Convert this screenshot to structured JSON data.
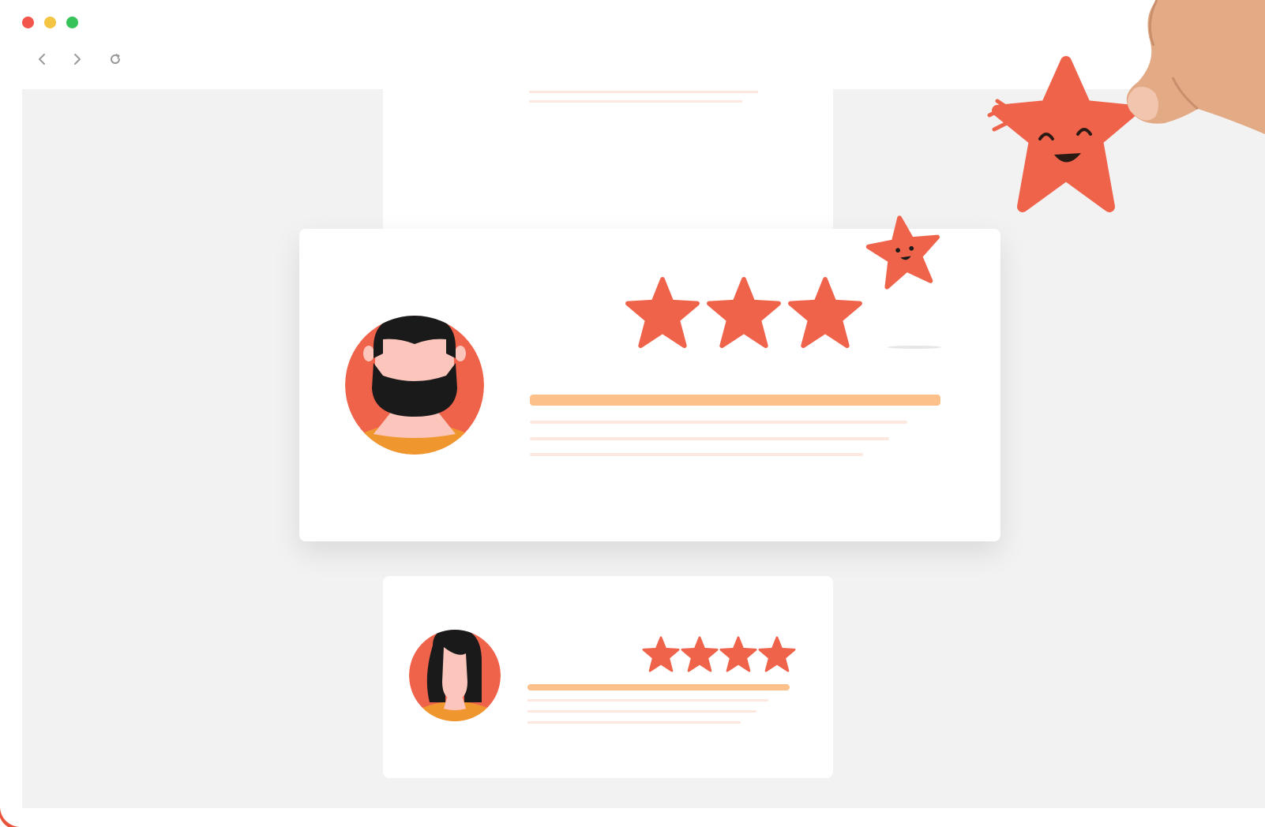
{
  "browser": {
    "traffic_lights": {
      "close": "#f2554b",
      "minimize": "#f4c542",
      "maximize": "#36c35a"
    },
    "nav": {
      "back_icon": "chevron-left-icon",
      "forward_icon": "chevron-right-icon",
      "reload_icon": "reload-icon"
    }
  },
  "colors": {
    "viewport_bg": "#f2f2f2",
    "card_bg": "#ffffff",
    "star": "#f0634b",
    "accent_bar": "#fcc18a",
    "text_line": "#fde8e0",
    "avatar_bg": "#f0634b",
    "avatar_shirt": "#f0962e",
    "skin": "#fcc6bd",
    "hair": "#1a1a1a"
  },
  "reviews": [
    {
      "id": "top",
      "avatar": "partial-avatar",
      "rating": null
    },
    {
      "id": "main",
      "avatar": "bearded-man-avatar",
      "rating": 3
    },
    {
      "id": "bottom",
      "avatar": "woman-avatar",
      "rating": 4
    }
  ],
  "decorations": {
    "happy_star": "happy-star-icon",
    "hand": "hand-holding-star"
  }
}
